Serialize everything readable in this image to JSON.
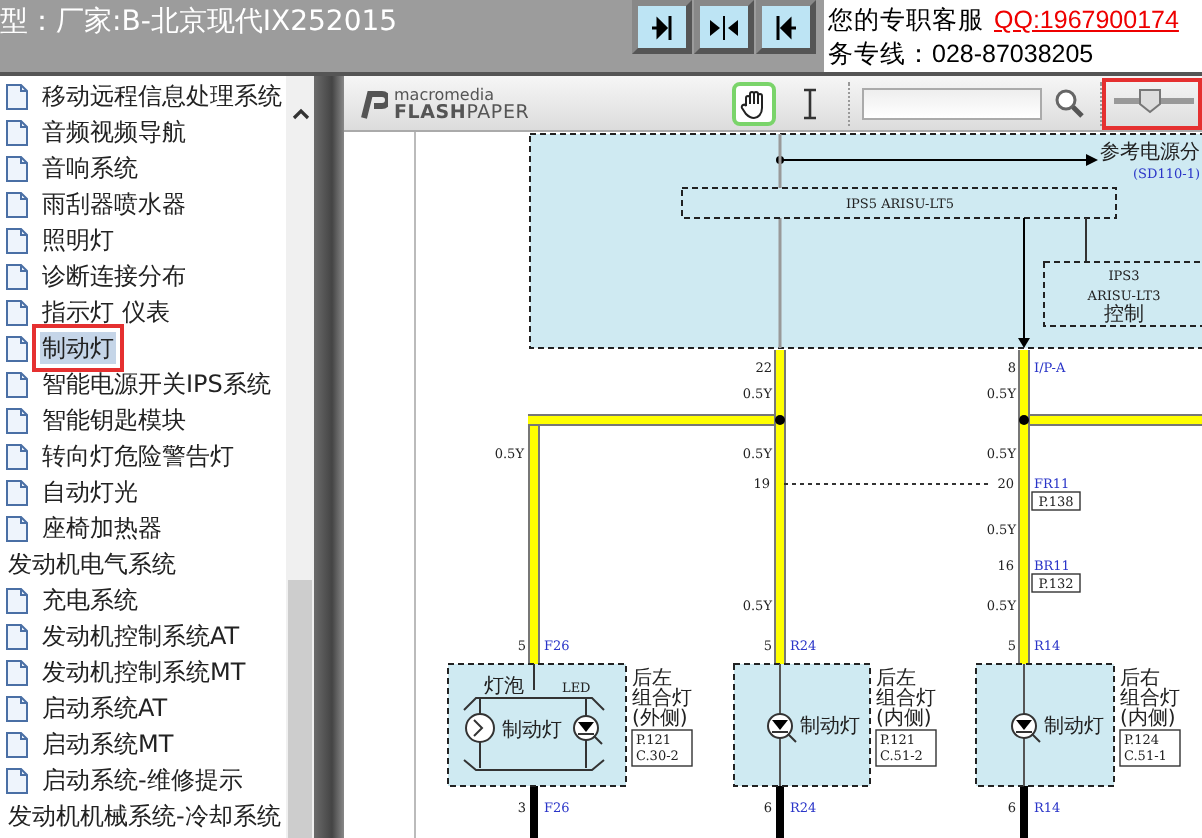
{
  "header": {
    "title": "型：厂家:B-北京现代IX252015"
  },
  "support": {
    "label": "您的专职客服",
    "qq": "QQ:1967900174",
    "hotline": "务专线：028-87038205"
  },
  "sidebar": {
    "items": [
      {
        "kind": "page",
        "label": "移动远程信息处理系统",
        "selected": false
      },
      {
        "kind": "page",
        "label": "音频视频导航",
        "selected": false
      },
      {
        "kind": "page",
        "label": "音响系统",
        "selected": false
      },
      {
        "kind": "page",
        "label": "雨刮器喷水器",
        "selected": false
      },
      {
        "kind": "page",
        "label": "照明灯",
        "selected": false
      },
      {
        "kind": "page",
        "label": "诊断连接分布",
        "selected": false
      },
      {
        "kind": "page",
        "label": "指示灯 仪表",
        "selected": false
      },
      {
        "kind": "page",
        "label": "制动灯",
        "selected": true
      },
      {
        "kind": "page",
        "label": "智能电源开关IPS系统",
        "selected": false
      },
      {
        "kind": "page",
        "label": "智能钥匙模块",
        "selected": false
      },
      {
        "kind": "page",
        "label": "转向灯危险警告灯",
        "selected": false
      },
      {
        "kind": "page",
        "label": "自动灯光",
        "selected": false
      },
      {
        "kind": "page",
        "label": "座椅加热器",
        "selected": false
      },
      {
        "kind": "folder",
        "label": "发动机电气系统",
        "selected": false,
        "children": [
          {
            "kind": "page",
            "label": "充电系统",
            "selected": false
          },
          {
            "kind": "page",
            "label": "发动机控制系统AT",
            "selected": false
          },
          {
            "kind": "page",
            "label": "发动机控制系统MT",
            "selected": false
          },
          {
            "kind": "page",
            "label": "启动系统AT",
            "selected": false
          },
          {
            "kind": "page",
            "label": "启动系统MT",
            "selected": false
          },
          {
            "kind": "page",
            "label": "启动系统-维修提示",
            "selected": false
          }
        ]
      },
      {
        "kind": "folder",
        "label": "发动机机械系统-冷却系统",
        "selected": false
      }
    ]
  },
  "viewer": {
    "logo": {
      "brand": "macromedia",
      "product": "**FLASH**PAPER"
    },
    "tools": [
      {
        "kind": "hand",
        "selected": true
      },
      {
        "kind": "text",
        "selected": false
      }
    ],
    "zoom": {
      "level": 0.45
    },
    "diagram": {
      "power_ref": {
        "title": "参考电源分",
        "code": "(SD110-1)"
      },
      "modules": [
        {
          "lines": [
            "IPS5 ARISU-LT5"
          ]
        },
        {
          "lines": [
            "IPS3",
            "ARISU-LT3",
            "控制"
          ]
        }
      ],
      "top_pins": [
        {
          "pin": "22"
        },
        {
          "pin": "8",
          "connector": "I/P-A"
        }
      ],
      "wire_specs": [
        "0.5Y",
        "0.5Y",
        "0.5Y",
        "0.5Y",
        "0.5Y",
        "0.5Y",
        "0.5Y",
        "0.5Y"
      ],
      "splices": [
        {
          "pin": "19"
        },
        {
          "pin": "20",
          "connector": "FR11",
          "page": "P.138"
        },
        {
          "pin": "16",
          "connector": "BR11",
          "page": "P.132"
        }
      ],
      "lamps": [
        {
          "kind": "bulb_led",
          "pin_in": "5",
          "connector_in": "F26",
          "name": [
            "后左",
            "组合灯",
            "(外侧)"
          ],
          "refs": [
            "P.121",
            "C.30-2"
          ],
          "label": "制动灯",
          "parts": [
            "灯泡",
            "LED"
          ],
          "pin_out": "3",
          "connector_out": "F26"
        },
        {
          "kind": "led",
          "pin_in": "5",
          "connector_in": "R24",
          "name": [
            "后左",
            "组合灯",
            "(内侧)"
          ],
          "refs": [
            "P.121",
            "C.51-2"
          ],
          "label": "制动灯",
          "pin_out": "6",
          "connector_out": "R24"
        },
        {
          "kind": "led",
          "pin_in": "5",
          "connector_in": "R14",
          "name": [
            "后右",
            "组合灯",
            "(内侧)"
          ],
          "refs": [
            "P.124",
            "C.51-1"
          ],
          "label": "制动灯",
          "pin_out": "6",
          "connector_out": "R14"
        }
      ]
    }
  }
}
